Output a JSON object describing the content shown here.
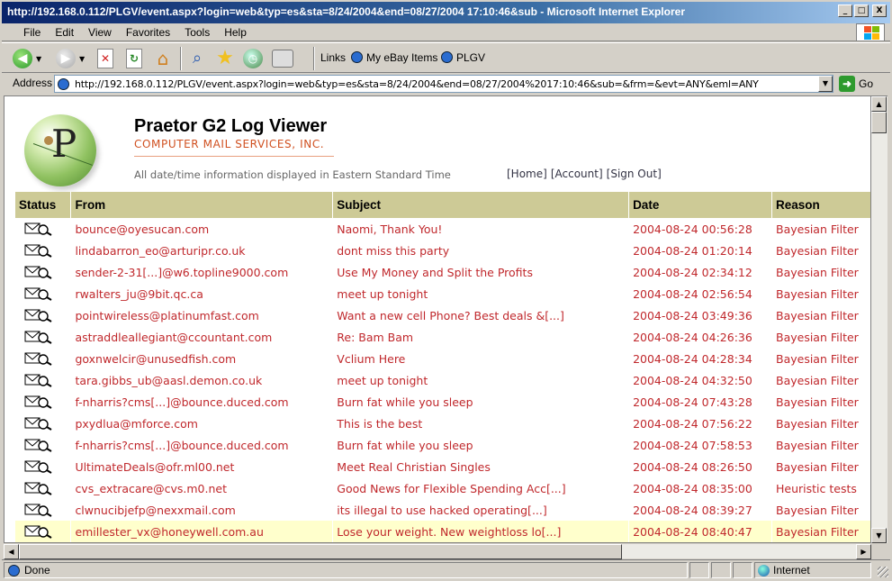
{
  "window": {
    "title": "http://192.168.0.112/PLGV/event.aspx?login=web&typ=es&sta=8/24/2004&end=08/27/2004 17:10:46&sub - Microsoft Internet Explorer",
    "minimize": "_",
    "maximize": "□",
    "close": "X"
  },
  "menu": [
    "File",
    "Edit",
    "View",
    "Favorites",
    "Tools",
    "Help"
  ],
  "toolbar": {
    "links_label": "Links",
    "link1": "My eBay Items",
    "link2": "PLGV"
  },
  "address": {
    "label": "Address",
    "url": "http://192.168.0.112/PLGV/event.aspx?login=web&typ=es&sta=8/24/2004&end=08/27/2004%2017:10:46&sub=&frm=&evt=ANY&eml=ANY",
    "go": "Go"
  },
  "page": {
    "title": "Praetor G2 Log Viewer",
    "company": "COMPUTER MAIL SERVICES, INC.",
    "tz_note": "All date/time information displayed in Eastern Standard Time",
    "nav": {
      "home": "[Home]",
      "account": "[Account]",
      "signout": "[Sign Out]"
    },
    "logo_letter": "P"
  },
  "table": {
    "headers": {
      "status": "Status",
      "from": "From",
      "subject": "Subject",
      "date": "Date",
      "reason": "Reason"
    },
    "rows": [
      {
        "from": "bounce@oyesucan.com",
        "subject": "Naomi, Thank You!",
        "date": "2004-08-24 00:56:28",
        "reason": "Bayesian Filter"
      },
      {
        "from": "lindabarron_eo@arturipr.co.uk",
        "subject": "dont miss this party",
        "date": "2004-08-24 01:20:14",
        "reason": "Bayesian Filter"
      },
      {
        "from": "sender-2-31[...]@w6.topline9000.com",
        "subject": "Use My Money and Split the Profits",
        "date": "2004-08-24 02:34:12",
        "reason": "Bayesian Filter"
      },
      {
        "from": "rwalters_ju@9bit.qc.ca",
        "subject": "meet up tonight",
        "date": "2004-08-24 02:56:54",
        "reason": "Bayesian Filter"
      },
      {
        "from": "pointwireless@platinumfast.com",
        "subject": "Want a new cell Phone? Best deals &[...]",
        "date": "2004-08-24 03:49:36",
        "reason": "Bayesian Filter"
      },
      {
        "from": "astraddleallegiant@ccountant.com",
        "subject": "Re: Bam Bam",
        "date": "2004-08-24 04:26:36",
        "reason": "Bayesian Filter"
      },
      {
        "from": "goxnwelcir@unusedfish.com",
        "subject": "Vclium Here",
        "date": "2004-08-24 04:28:34",
        "reason": "Bayesian Filter"
      },
      {
        "from": "tara.gibbs_ub@aasl.demon.co.uk",
        "subject": "meet up tonight",
        "date": "2004-08-24 04:32:50",
        "reason": "Bayesian Filter"
      },
      {
        "from": "f-nharris?cms[...]@bounce.duced.com",
        "subject": "Burn fat while you sleep",
        "date": "2004-08-24 07:43:28",
        "reason": "Bayesian Filter"
      },
      {
        "from": "pxydlua@mforce.com",
        "subject": "This is the best",
        "date": "2004-08-24 07:56:22",
        "reason": "Bayesian Filter"
      },
      {
        "from": "f-nharris?cms[...]@bounce.duced.com",
        "subject": "Burn fat while you sleep",
        "date": "2004-08-24 07:58:53",
        "reason": "Bayesian Filter"
      },
      {
        "from": "UltimateDeals@ofr.ml00.net",
        "subject": "Meet Real Christian Singles",
        "date": "2004-08-24 08:26:50",
        "reason": "Bayesian Filter"
      },
      {
        "from": "cvs_extracare@cvs.m0.net",
        "subject": "Good News for Flexible Spending Acc[...]",
        "date": "2004-08-24 08:35:00",
        "reason": "Heuristic tests"
      },
      {
        "from": "clwnucibjefp@nexxmail.com",
        "subject": "its illegal to use hacked operating[...]",
        "date": "2004-08-24 08:39:27",
        "reason": "Bayesian Filter"
      },
      {
        "from": "emillester_vx@honeywell.com.au",
        "subject": "Lose your weight. New weightloss lo[...]",
        "date": "2004-08-24 08:40:47",
        "reason": "Bayesian Filter"
      }
    ]
  },
  "status": {
    "text": "Done",
    "zone": "Internet"
  },
  "colors": {
    "header_bg": "#cdca96",
    "row_text": "#c0282c",
    "company": "#d05020",
    "highlight_row": "#ffffcc"
  }
}
